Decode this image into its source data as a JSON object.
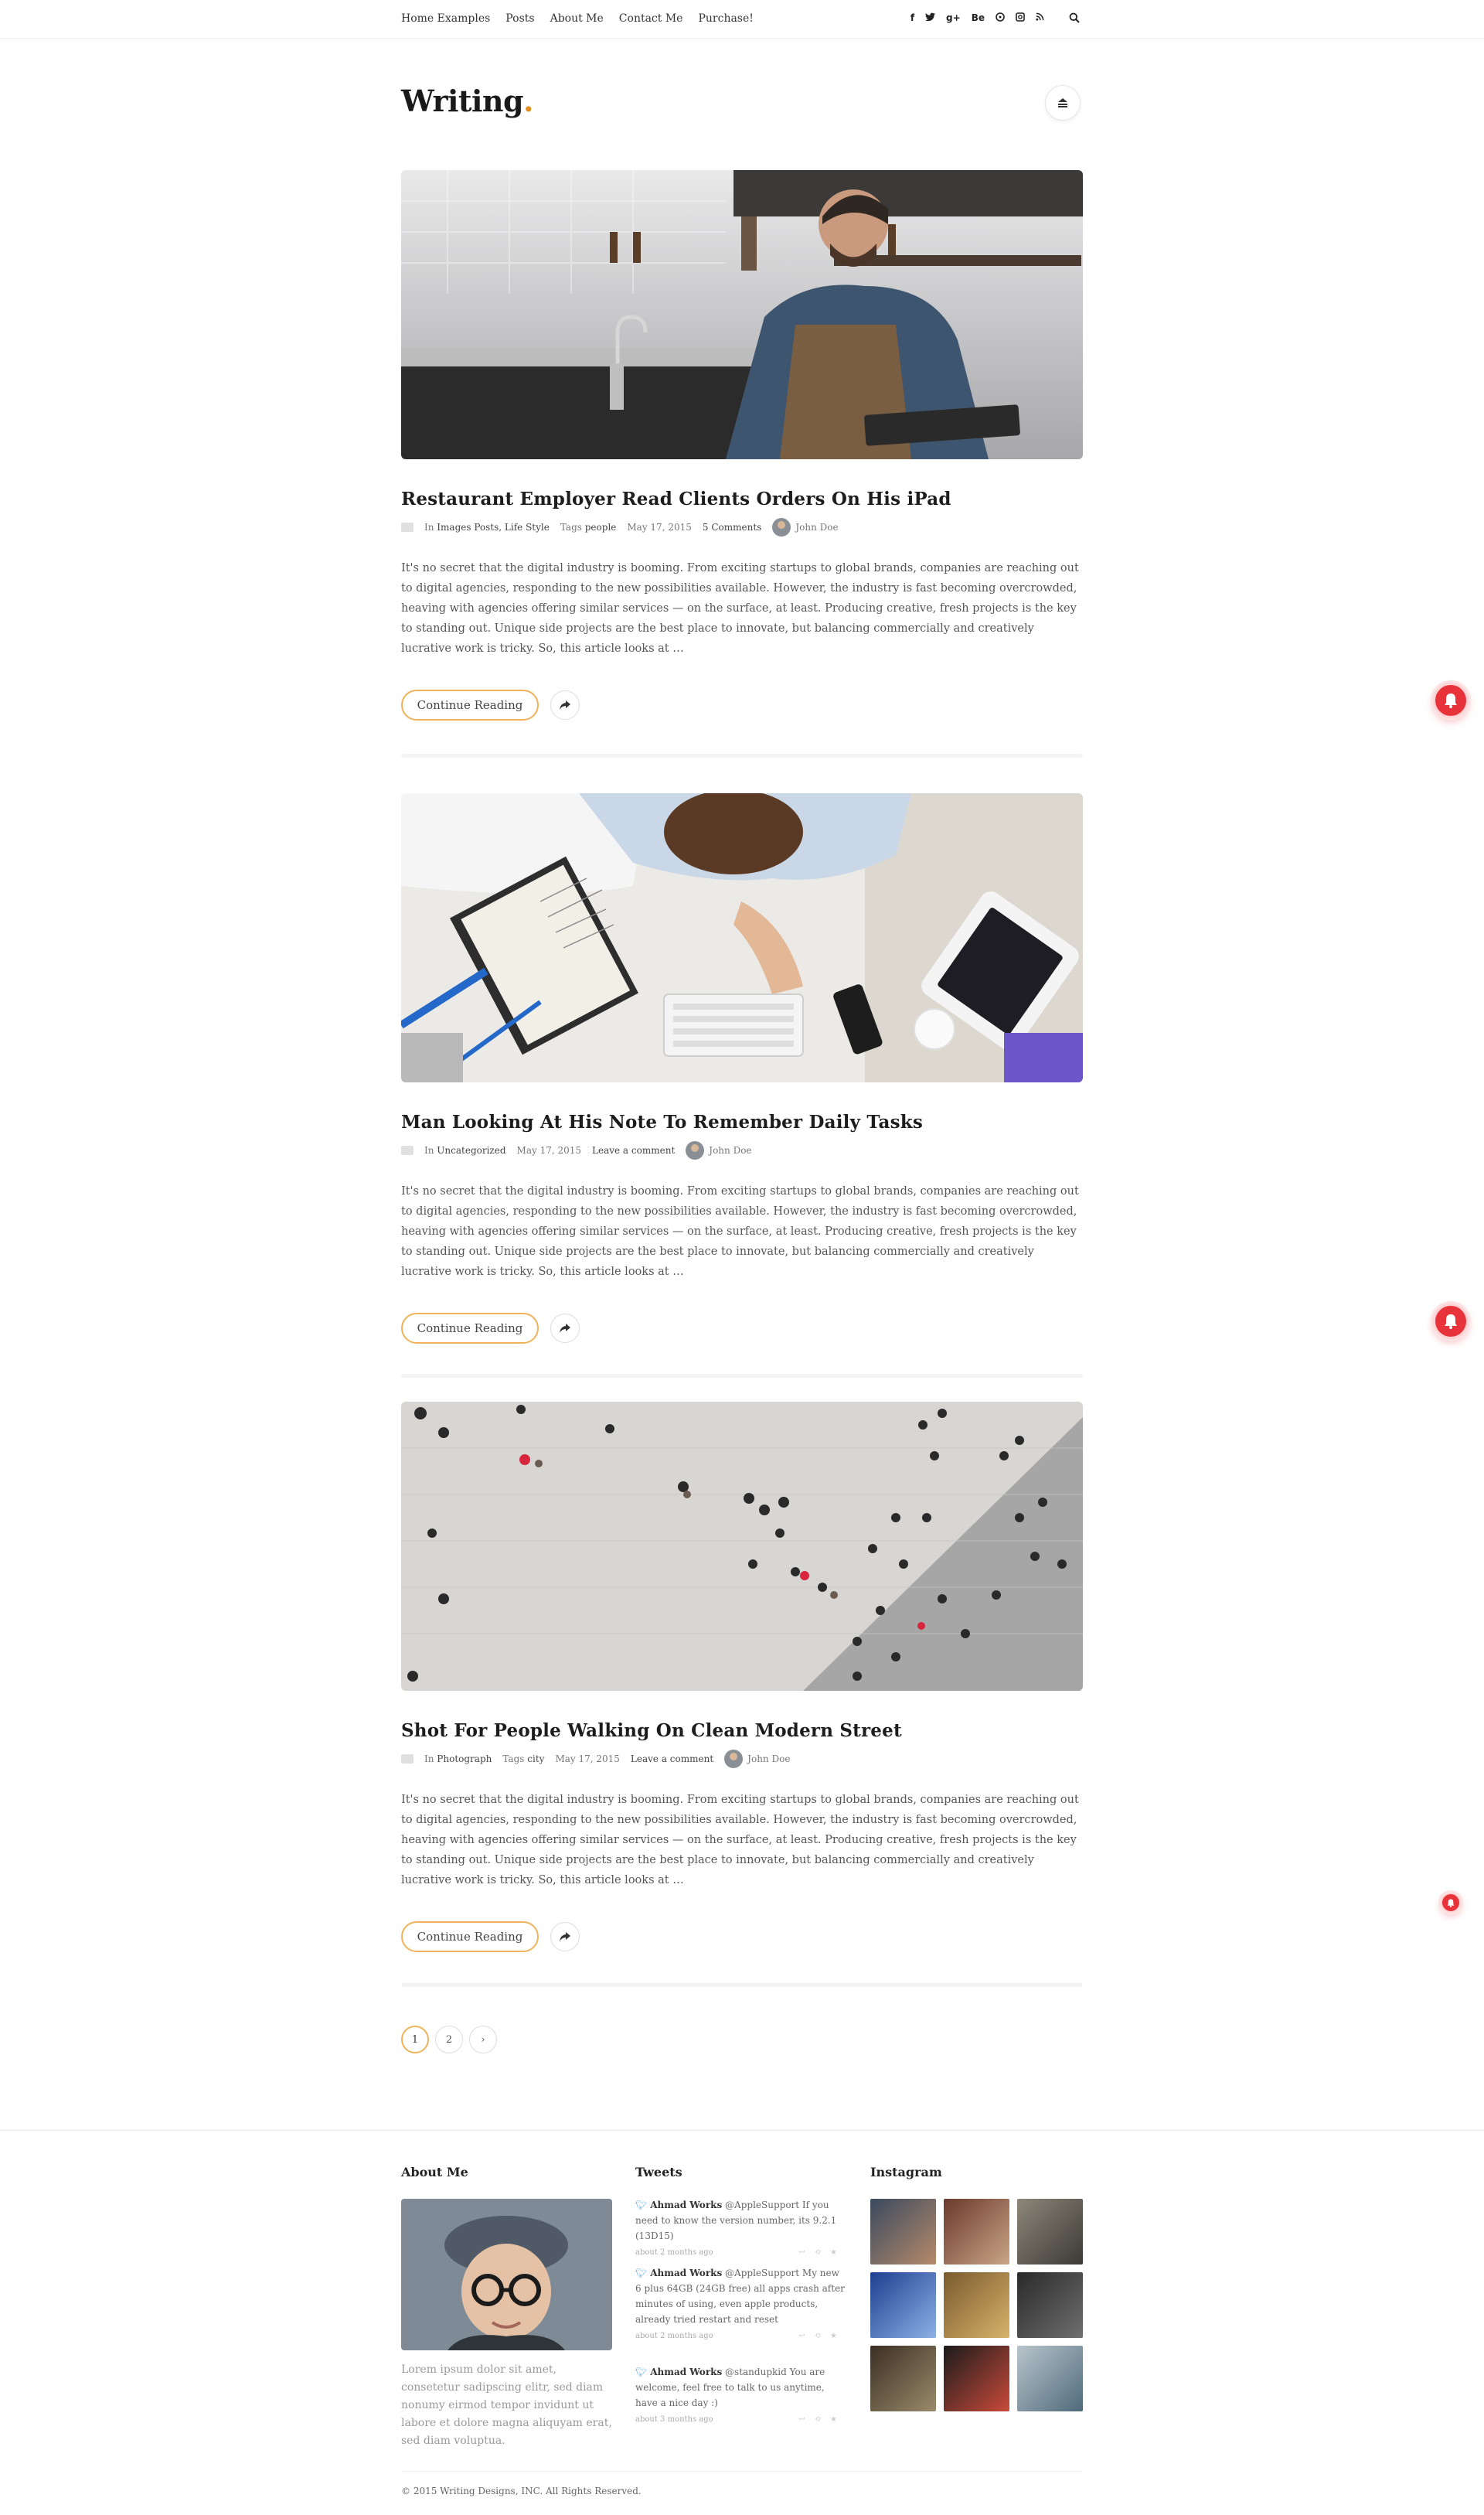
{
  "nav": {
    "menu": [
      "Home Examples",
      "Posts",
      "About Me",
      "Contact Me",
      "Purchase!"
    ],
    "social": [
      "f",
      "t",
      "g+",
      "Be",
      "◎",
      "◻",
      "rss"
    ]
  },
  "site": {
    "logo": "Writing",
    "logo_dot": "."
  },
  "posts": [
    {
      "title": "Restaurant Employer Read Clients Orders On His iPad",
      "category_prefix": "In",
      "categories": "Images Posts, Life Style",
      "tags_prefix": "Tags",
      "tags": "people",
      "date": "May 17, 2015",
      "comments": "5 Comments",
      "author": "John Doe",
      "excerpt": "It's no secret that the digital industry is booming. From exciting startups to global brands, companies are reaching out to digital agencies, responding to the new possibilities available. However, the industry is fast becoming overcrowded, heaving with agencies offering similar services — on the surface, at least. Producing creative, fresh projects is the key to standing out. Unique side projects are the best place to innovate, but balancing commercially and creatively lucrative work is tricky. So, this article looks at …",
      "read_more": "Continue Reading"
    },
    {
      "title": "Man Looking At His Note To Remember Daily Tasks",
      "category_prefix": "In",
      "categories": "Uncategorized",
      "date": "May 17, 2015",
      "comments": "Leave a comment",
      "author": "John Doe",
      "excerpt": "It's no secret that the digital industry is booming. From exciting startups to global brands, companies are reaching out to digital agencies, responding to the new possibilities available. However, the industry is fast becoming overcrowded, heaving with agencies offering similar services — on the surface, at least. Producing creative, fresh projects is the key to standing out. Unique side projects are the best place to innovate, but balancing commercially and creatively lucrative work is tricky. So, this article looks at …",
      "read_more": "Continue Reading"
    },
    {
      "title": "Shot For People Walking On Clean Modern Street",
      "category_prefix": "In",
      "categories": "Photograph",
      "tags_prefix": "Tags",
      "tags": "city",
      "date": "May 17, 2015",
      "comments": "Leave a comment",
      "author": "John Doe",
      "excerpt": "It's no secret that the digital industry is booming. From exciting startups to global brands, companies are reaching out to digital agencies, responding to the new possibilities available. However, the industry is fast becoming overcrowded, heaving with agencies offering similar services — on the surface, at least. Producing creative, fresh projects is the key to standing out. Unique side projects are the best place to innovate, but balancing commercially and creatively lucrative work is tricky. So, this article looks at …",
      "read_more": "Continue Reading"
    }
  ],
  "pagination": {
    "pages": [
      "1",
      "2"
    ],
    "next": "›",
    "current": "1"
  },
  "footer": {
    "about": {
      "heading": "About Me",
      "text": "Lorem ipsum dolor sit amet, consetetur sadipscing elitr, sed diam nonumy eirmod tempor invidunt ut labore et dolore magna aliquyam erat, sed diam voluptua."
    },
    "tweets": {
      "heading": "Tweets",
      "items": [
        {
          "author": "Ahmad Works",
          "text": "@AppleSupport If you need to know the version number, its 9.2.1 (13D15)",
          "time": "about 2 months ago"
        },
        {
          "author": "Ahmad Works",
          "text": "@AppleSupport My new 6 plus 64GB (24GB free) all apps crash after minutes of using, even apple products, already tried restart and reset",
          "time": "about 2 months ago"
        },
        {
          "author": "Ahmad Works",
          "text": "@standupkid You are welcome, feel free to talk to us anytime, have a nice day :)",
          "time": "about 3 months ago"
        }
      ]
    },
    "instagram": {
      "heading": "Instagram"
    },
    "copyright": "© 2015 Writing Designs, INC. All Rights Reserved."
  },
  "colors": {
    "accent": "#f0b35c",
    "logo_dot": "#e58c1a",
    "badge": "#e8333b"
  }
}
